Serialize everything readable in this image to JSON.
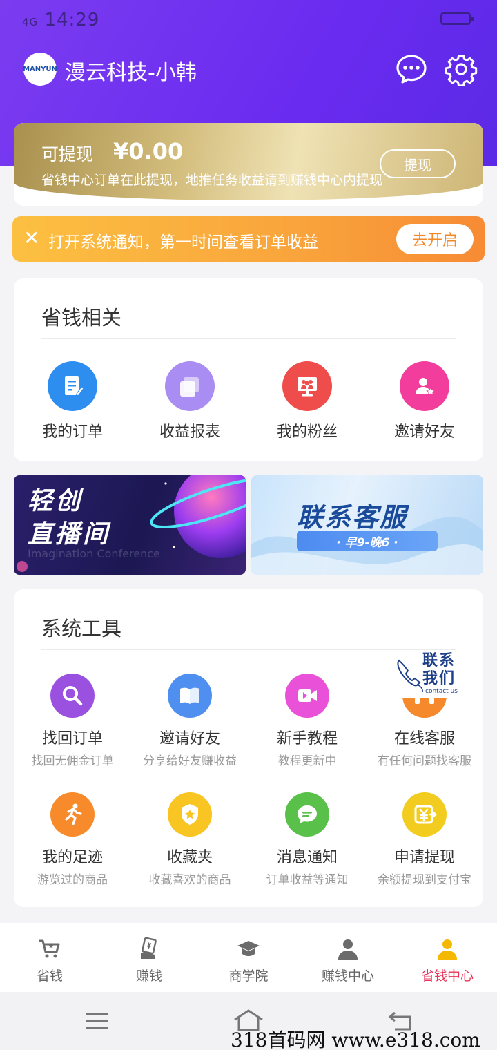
{
  "status_bar": {
    "signal": "4G",
    "time": "14:29"
  },
  "header": {
    "logo_text": "MANYUN",
    "brand": "漫云科技-小韩"
  },
  "withdraw_card": {
    "label": "可提现",
    "amount": "¥0.00",
    "description": "省钱中心订单在此提现，地推任务收益请到赚钱中心内提现",
    "button": "提现"
  },
  "notice": {
    "text": "打开系统通知，第一时间查看订单收益",
    "button": "去开启"
  },
  "savings_section": {
    "title": "省钱相关",
    "items": [
      {
        "label": "我的订单",
        "icon": "order-icon",
        "color": "#2d8ef0"
      },
      {
        "label": "收益报表",
        "icon": "report-icon",
        "color": "#a98df2"
      },
      {
        "label": "我的粉丝",
        "icon": "fans-icon",
        "color": "#ef4c4c"
      },
      {
        "label": "邀请好友",
        "icon": "invite-icon",
        "color": "#f33d9c"
      }
    ]
  },
  "banners": {
    "live": {
      "title_line1": "轻创",
      "title_line2": "直播间",
      "subtitle": "Imagination Conference"
    },
    "service": {
      "title": "联系客服",
      "hours": "· 早9-晚6 ·"
    }
  },
  "tools_section": {
    "title": "系统工具",
    "items": [
      {
        "label": "找回订单",
        "sub": "找回无佣金订单",
        "icon": "search-icon",
        "color": "#9b51e0"
      },
      {
        "label": "邀请好友",
        "sub": "分享给好友赚收益",
        "icon": "book-icon",
        "color": "#4f8ff0"
      },
      {
        "label": "新手教程",
        "sub": "教程更新中",
        "icon": "video-icon",
        "color": "#e851d8"
      },
      {
        "label": "在线客服",
        "sub": "有任何问题找客服",
        "icon": "headset-icon",
        "color": "#f5892c"
      },
      {
        "label": "我的足迹",
        "sub": "游览过的商品",
        "icon": "runner-icon",
        "color": "#f78a2a"
      },
      {
        "label": "收藏夹",
        "sub": "收藏喜欢的商品",
        "icon": "star-shield-icon",
        "color": "#f9c522"
      },
      {
        "label": "消息通知",
        "sub": "订单收益等通知",
        "icon": "message-icon",
        "color": "#59c14a"
      },
      {
        "label": "申请提现",
        "sub": "余额提现到支付宝",
        "icon": "yuan-icon",
        "color": "#f2cc1f"
      }
    ]
  },
  "floating_contact": {
    "text_line1": "联系",
    "text_line2": "我们",
    "sub": "contact us"
  },
  "tabbar": {
    "items": [
      {
        "label": "省钱",
        "icon": "cart-icon"
      },
      {
        "label": "赚钱",
        "icon": "earn-icon"
      },
      {
        "label": "商学院",
        "icon": "graduation-cap-icon"
      },
      {
        "label": "赚钱中心",
        "icon": "user-icon"
      },
      {
        "label": "省钱中心",
        "icon": "user-active-icon"
      }
    ],
    "active_color": "#e8345a"
  },
  "watermark": "318首码网  www.e318.com"
}
